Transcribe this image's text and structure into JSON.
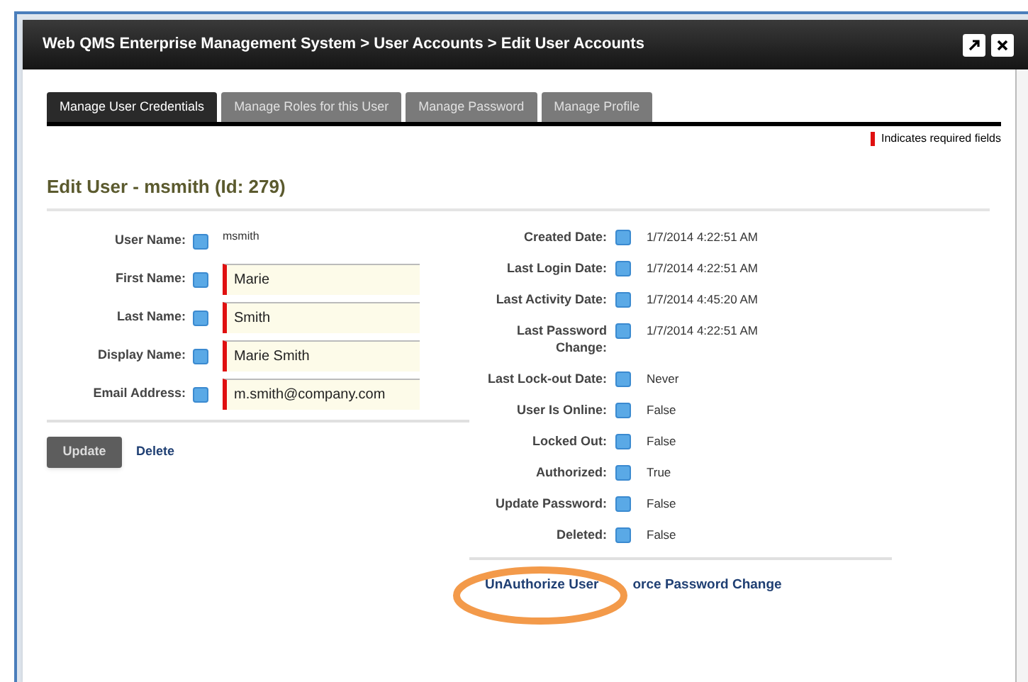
{
  "window": {
    "title": "Web QMS Enterprise Management System > User Accounts > Edit User Accounts"
  },
  "tabs": [
    {
      "label": "Manage User Credentials",
      "selected": true
    },
    {
      "label": "Manage Roles for this User",
      "selected": false
    },
    {
      "label": "Manage Password",
      "selected": false
    },
    {
      "label": "Manage Profile",
      "selected": false
    }
  ],
  "required_note": "Indicates required fields",
  "heading": "Edit User - msmith (Id: 279)",
  "account_fields": [
    {
      "label": "User Name:",
      "kind": "text",
      "value": "msmith"
    },
    {
      "label": "First Name:",
      "kind": "input",
      "value": "Marie"
    },
    {
      "label": "Last Name:",
      "kind": "input",
      "value": "Smith"
    },
    {
      "label": "Display Name:",
      "kind": "input",
      "value": "Marie Smith"
    },
    {
      "label": "Email Address:",
      "kind": "input",
      "value": "m.smith@company.com"
    }
  ],
  "actions": {
    "button": "Update",
    "link": "Delete"
  },
  "info_fields": [
    {
      "label": "Created Date:",
      "value": "1/7/2014 4:22:51 AM"
    },
    {
      "label": "Last Login Date:",
      "value": "1/7/2014 4:22:51 AM"
    },
    {
      "label": "Last Activity Date:",
      "value": "1/7/2014 4:45:20 AM"
    },
    {
      "label": "Last Password Change:",
      "value": "1/7/2014 4:22:51 AM"
    },
    {
      "label": "Last Lock-out Date:",
      "value": "Never"
    },
    {
      "label": "User Is Online:",
      "value": "False"
    },
    {
      "label": "Locked Out:",
      "value": "False"
    },
    {
      "label": "Authorized:",
      "value": "True"
    },
    {
      "label": "Update Password:",
      "value": "False"
    },
    {
      "label": "Deleted:",
      "value": "False"
    }
  ],
  "links": [
    "UnAuthorize User",
    "orce Password Change"
  ]
}
